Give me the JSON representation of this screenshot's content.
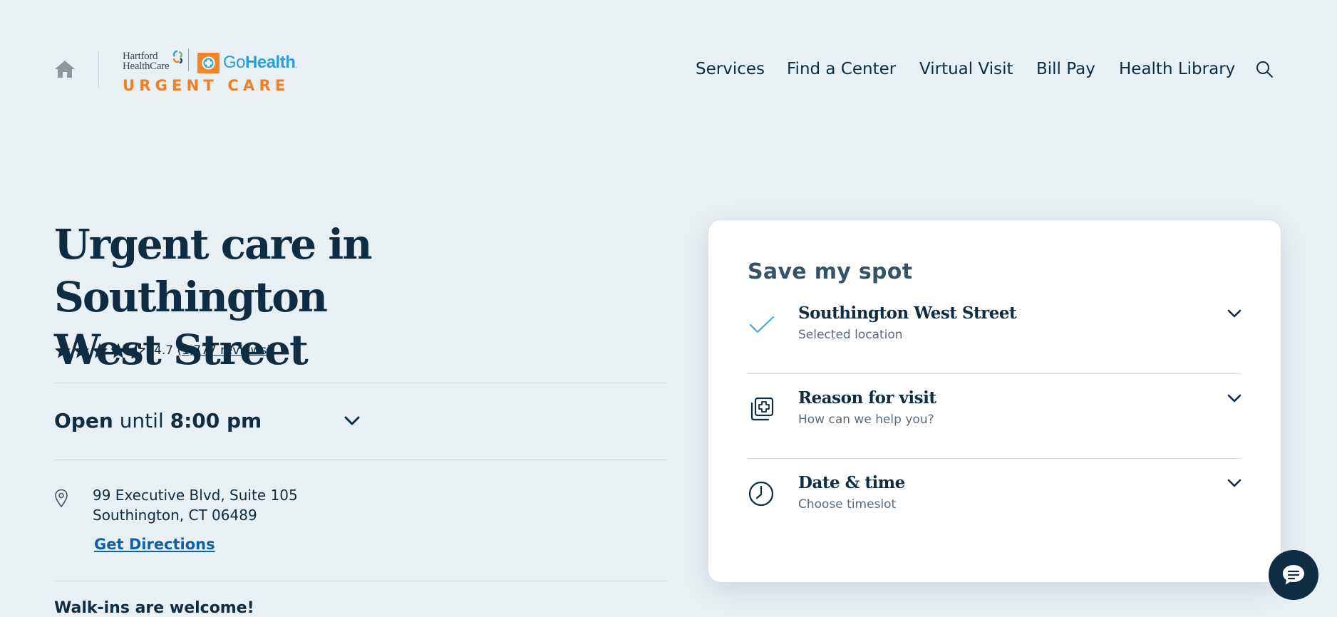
{
  "header": {
    "logo": {
      "partner_name_line1": "Hartford",
      "partner_name_line2": "HealthCare",
      "brand_prefix": "Go",
      "brand_suffix": "Health",
      "brand_dot": ".",
      "tagline": "URGENT CARE"
    },
    "nav": [
      {
        "label": "Services"
      },
      {
        "label": "Find a Center"
      },
      {
        "label": "Virtual Visit"
      },
      {
        "label": "Bill Pay"
      },
      {
        "label": "Health Library"
      }
    ],
    "icons": {
      "home": "home-icon",
      "search": "search-icon"
    }
  },
  "main": {
    "title_line1": "Urgent care in Southington",
    "title_line2": "West Street",
    "rating": {
      "value": "4.7",
      "stars": 4.5,
      "open_paren": "(",
      "reviews_label": "1,777 reviews",
      "close_paren": ")"
    },
    "hours": {
      "status": "Open",
      "mid": "until",
      "time": "8:00 pm"
    },
    "address": {
      "line1": "99 Executive Blvd, Suite 105",
      "line2": "Southington, CT 06489",
      "directions_label": "Get Directions"
    },
    "next_section_label": "Walk-ins are welcome!"
  },
  "card": {
    "title": "Save my spot",
    "steps": [
      {
        "title": "Southington West Street",
        "subtitle": "Selected location",
        "icon": "check-icon"
      },
      {
        "title": "Reason for visit",
        "subtitle": "How can we help you?",
        "icon": "medical-cross-icon"
      },
      {
        "title": "Date & time",
        "subtitle": "Choose timeslot",
        "icon": "clock-icon"
      }
    ]
  },
  "colors": {
    "background": "#e8f0f3",
    "text_primary": "#0e2c42",
    "brand_orange": "#ef7f22",
    "brand_blue": "#2a9fd8",
    "link": "#1060a8",
    "check": "#4aa8d8"
  },
  "chat": {
    "icon": "chat-bubble-icon"
  }
}
